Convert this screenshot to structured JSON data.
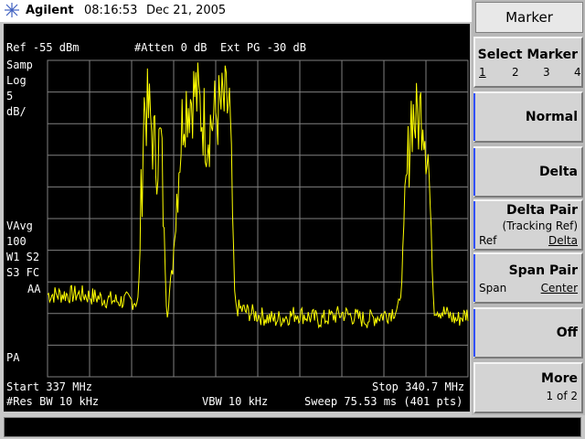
{
  "header": {
    "brand": "Agilent",
    "time": "08:16:53",
    "date": "Dec 21, 2005"
  },
  "screen": {
    "ref_level": "Ref -55 dBm",
    "atten": "#Atten 0 dB",
    "ext_pg": "Ext PG -30 dB",
    "left_annotations": {
      "samp": "Samp",
      "log": "Log",
      "scale_value": "5",
      "scale_unit": "dB/",
      "vavg": "VAvg",
      "vavg_count": "100",
      "w1s2": "W1 S2",
      "s3fc": "S3 FC",
      "aa": "AA",
      "pa": "PA"
    },
    "start_freq": "Start 337 MHz",
    "stop_freq": "Stop 340.7 MHz",
    "res_bw": "#Res BW 10 kHz",
    "vbw": "VBW 10 kHz",
    "sweep": "Sweep 75.53 ms (401 pts)",
    "trace_color": "#ffff00",
    "grid_color": "#808080"
  },
  "chart_data": {
    "type": "line",
    "x_range_mhz": [
      337,
      340.7
    ],
    "y_reference_dbm": -55,
    "y_scale_db_per_div": 5,
    "y_divisions": 10,
    "grid": true,
    "series": [
      {
        "x": [
          337.0,
          337.3,
          337.6,
          337.8,
          337.85,
          337.9,
          337.95,
          338.0,
          338.05,
          338.1,
          338.15,
          338.2,
          338.3,
          338.4,
          338.5,
          338.6,
          338.65,
          338.8,
          339.0,
          339.2,
          339.4,
          339.6,
          339.8,
          340.0,
          340.1,
          340.15,
          340.2,
          340.25,
          340.3,
          340.35,
          340.4,
          340.5,
          340.6,
          340.7
        ],
        "y": [
          -92,
          -92,
          -93,
          -93,
          -62,
          -64,
          -70,
          -68,
          -95,
          -88,
          -72,
          -62,
          -60,
          -66,
          -63,
          -62,
          -94,
          -95,
          -96,
          -95,
          -96,
          -95,
          -96,
          -95,
          -94,
          -78,
          -63,
          -65,
          -62,
          -70,
          -94,
          -95,
          -96,
          -95
        ]
      }
    ]
  },
  "panel": {
    "title": "Marker",
    "keys": [
      {
        "label": "Select Marker",
        "sub": [
          "1",
          "2",
          "3",
          "4"
        ]
      },
      {
        "label": "Normal"
      },
      {
        "label": "Delta"
      },
      {
        "label": "Delta Pair",
        "sub1": "(Tracking Ref)",
        "left": "Ref",
        "right": "Delta"
      },
      {
        "label": "Span Pair",
        "left": "Span",
        "right": "Center"
      },
      {
        "label": "Off"
      },
      {
        "label": "More",
        "sub1": "1 of 2"
      }
    ]
  }
}
